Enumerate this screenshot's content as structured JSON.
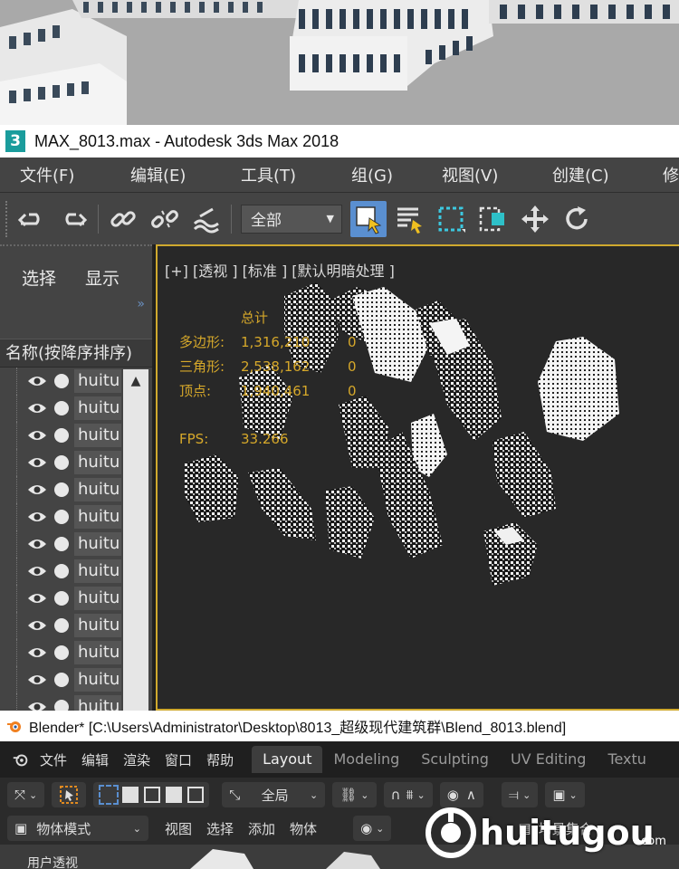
{
  "max_window": {
    "title": "MAX_8013.max - Autodesk 3ds Max 2018",
    "logo_text": "3",
    "menu": [
      "文件(F)",
      "编辑(E)",
      "工具(T)",
      "组(G)",
      "视图(V)",
      "创建(C)",
      "修"
    ],
    "toolbar": {
      "selection_filter": "全部",
      "icons": [
        "undo-icon",
        "redo-icon",
        "link-icon",
        "unlink-icon",
        "bind-space-warp-icon",
        "select-object-icon",
        "select-by-name-icon",
        "rect-selection-icon",
        "window-crossing-icon",
        "move-icon",
        "rotate-icon"
      ]
    },
    "scene_explorer": {
      "tabs": [
        "选择",
        "显示"
      ],
      "sort_header": "名称(按降序排序)",
      "items": [
        "huitu",
        "huitu",
        "huitu",
        "huitu",
        "huitu",
        "huitu",
        "huitu",
        "huitu",
        "huitu",
        "huitu",
        "huitu",
        "huitu",
        "huitu"
      ]
    },
    "viewport": {
      "label": "[+] [透视 ] [标准 ] [默认明暗处理 ]",
      "stats": {
        "header": "总计",
        "polygons_label": "多边形:",
        "polygons_value": "1,316,210",
        "polygons_sel": "0",
        "triangles_label": "三角形:",
        "triangles_value": "2,538,162",
        "triangles_sel": "0",
        "vertices_label": "顶点:",
        "vertices_value": "1,940,461",
        "vertices_sel": "0",
        "fps_label": "FPS:",
        "fps_value": "33.266"
      }
    }
  },
  "blender_window": {
    "title": "Blender* [C:\\Users\\Administrator\\Desktop\\8013_超级现代建筑群\\Blend_8013.blend]",
    "menu": [
      "文件",
      "编辑",
      "渲染",
      "窗口",
      "帮助"
    ],
    "workspaces": [
      "Layout",
      "Modeling",
      "Sculpting",
      "UV Editing",
      "Textu"
    ],
    "active_workspace": "Layout",
    "header": {
      "transform_orientation": "全局",
      "mode": "物体模式",
      "view_menu": [
        "视图",
        "选择",
        "添加",
        "物体"
      ],
      "scene_collection": "场景集合",
      "viewport_label": "用户透视"
    }
  },
  "watermark": {
    "text": "huitugou",
    "suffix": ".com"
  }
}
